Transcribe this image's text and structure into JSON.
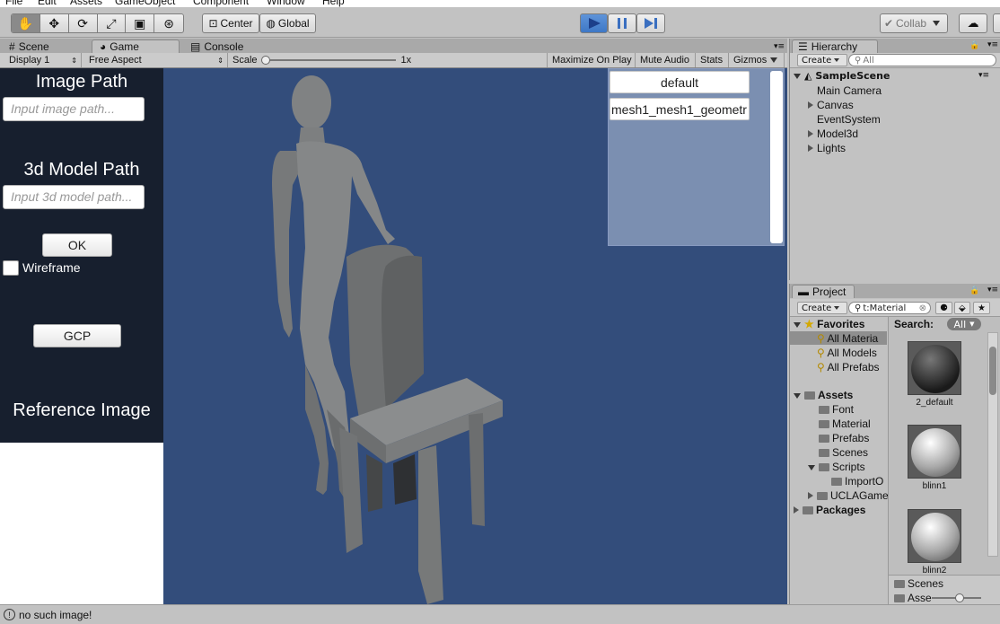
{
  "menu": {
    "items": [
      "File",
      "Edit",
      "Assets",
      "GameObject",
      "Component",
      "Window",
      "Help"
    ]
  },
  "toolbar": {
    "tools": [
      "hand-icon",
      "move-icon",
      "rotate-icon",
      "scale-icon",
      "rect-icon",
      "transform-icon"
    ],
    "pivot": "Center",
    "space": "Global",
    "collab": "Collab",
    "accent": "#3e78c6"
  },
  "tabs": {
    "scene": "Scene",
    "game": "Game",
    "console": "Console"
  },
  "gamebar": {
    "display": "Display 1",
    "aspect": "Free Aspect",
    "scale_label": "Scale",
    "scale_value": "1x",
    "maximize": "Maximize On Play",
    "mute": "Mute Audio",
    "stats": "Stats",
    "gizmos": "Gizmos"
  },
  "left_ui": {
    "image_path_label": "Image Path",
    "image_path_placeholder": "Input image path...",
    "model_path_label": "3d Model Path",
    "model_path_placeholder": "Input 3d model path...",
    "ok_button": "OK",
    "wireframe_label": "Wireframe",
    "gcp_button": "GCP",
    "reference_label": "Reference Image"
  },
  "mesh_list": [
    "default",
    "mesh1_mesh1_geometr"
  ],
  "hierarchy": {
    "tab": "Hierarchy",
    "create": "Create",
    "search_placeholder": "All",
    "scene": "SampleScene",
    "items": [
      "Main Camera",
      "Canvas",
      "EventSystem",
      "Model3d",
      "Lights"
    ]
  },
  "project": {
    "tab": "Project",
    "create": "Create",
    "search_value": "t:Material",
    "favorites": "Favorites",
    "favorite_items": [
      "All Materia",
      "All Models",
      "All Prefabs"
    ],
    "assets": "Assets",
    "asset_items": [
      "Font",
      "Material",
      "Prefabs",
      "Scenes",
      "Scripts",
      "ImportO",
      "UCLAGame"
    ],
    "packages": "Packages",
    "search_label": "Search:",
    "search_scope": "All",
    "materials": [
      "2_default",
      "blinn1",
      "blinn2"
    ],
    "bottom": [
      "Scenes",
      "Asse"
    ]
  },
  "status": {
    "message": "no such image!"
  }
}
